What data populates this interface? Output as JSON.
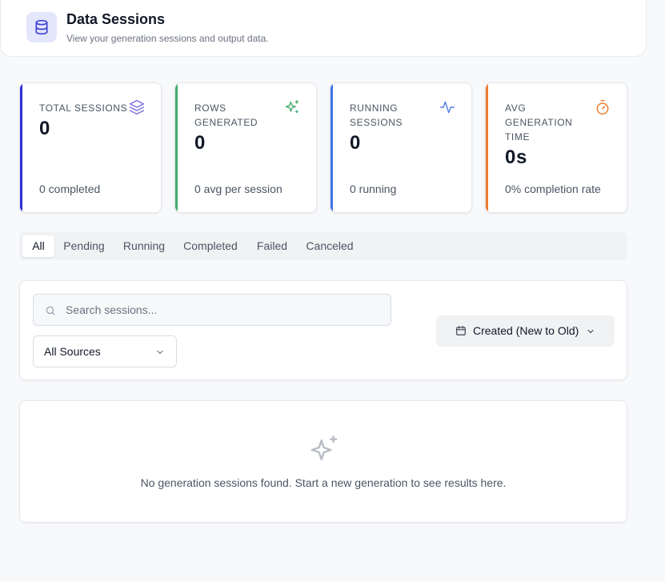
{
  "header": {
    "title": "Data Sessions",
    "subtitle": "View your generation sessions and output data.",
    "icon": "database-icon"
  },
  "stats": [
    {
      "label": "TOTAL SESSIONS",
      "value": "0",
      "footer": "0 completed",
      "icon": "layers-icon",
      "accent": "#2d2fd6",
      "icon_color": "#7c6fe0"
    },
    {
      "label": "ROWS GENERATED",
      "value": "0",
      "footer": "0 avg per session",
      "icon": "sparkles-icon",
      "accent": "#3fae6a",
      "icon_color": "#4caf72"
    },
    {
      "label": "RUNNING SESSIONS",
      "value": "0",
      "footer": "0 running",
      "icon": "activity-icon",
      "accent": "#3d73e8",
      "icon_color": "#4f7fe0"
    },
    {
      "label": "AVG GENERATION TIME",
      "value": "0s",
      "footer": "0% completion rate",
      "icon": "timer-icon",
      "accent": "#ef7a2e",
      "icon_color": "#f07c30"
    }
  ],
  "tabs": [
    {
      "label": "All",
      "active": true
    },
    {
      "label": "Pending",
      "active": false
    },
    {
      "label": "Running",
      "active": false
    },
    {
      "label": "Completed",
      "active": false
    },
    {
      "label": "Failed",
      "active": false
    },
    {
      "label": "Canceled",
      "active": false
    }
  ],
  "filters": {
    "search_placeholder": "Search sessions...",
    "search_value": "",
    "source_selected": "All Sources",
    "sort_label": "Created (New to Old)"
  },
  "empty_state": {
    "message": "No generation sessions found. Start a new generation to see results here.",
    "icon": "sparkles-icon"
  }
}
